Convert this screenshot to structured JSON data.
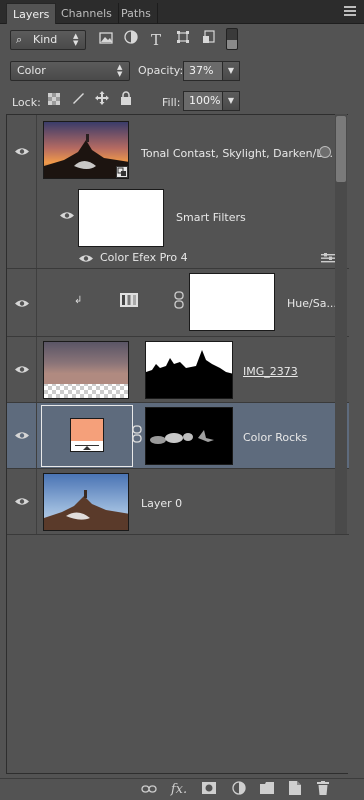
{
  "tabs": [
    "Layers",
    "Channels",
    "Paths"
  ],
  "filter": {
    "kind_label": "Kind"
  },
  "blend": {
    "mode": "Color",
    "opacity_label": "Opacity:",
    "opacity_value": "37%"
  },
  "lock": {
    "label": "Lock:",
    "fill_label": "Fill:",
    "fill_value": "100%"
  },
  "layers": [
    {
      "name": "Tonal Contast, Skylight, Darken/L...",
      "type": "smart-object"
    },
    {
      "name": "Smart Filters",
      "type": "smart-filters"
    },
    {
      "name": "Color Efex Pro 4",
      "type": "filter"
    },
    {
      "name": "Hue/Sa...",
      "type": "adjustment"
    },
    {
      "name": "IMG_2373",
      "type": "masked-image"
    },
    {
      "name": "Color Rocks",
      "type": "fill",
      "selected": true,
      "swatch": "#f5a07a"
    },
    {
      "name": "Layer 0",
      "type": "image"
    }
  ],
  "icons": {
    "filter_buttons": [
      "image-filter-icon",
      "adjustment-filter-icon",
      "type-filter-icon",
      "shape-filter-icon",
      "smart-object-filter-icon",
      "filter-toggle-icon"
    ],
    "lock_buttons": [
      "lock-transparent-icon",
      "lock-image-icon",
      "lock-position-icon",
      "lock-all-icon"
    ],
    "bottom_buttons": [
      "link-icon",
      "fx-icon",
      "mask-icon",
      "adjustment-icon",
      "group-icon",
      "new-layer-icon",
      "trash-icon"
    ]
  },
  "colors": {
    "panel": "#535353",
    "selected_row": "#5e6b7d",
    "tabbar": "#2c2c2c"
  }
}
